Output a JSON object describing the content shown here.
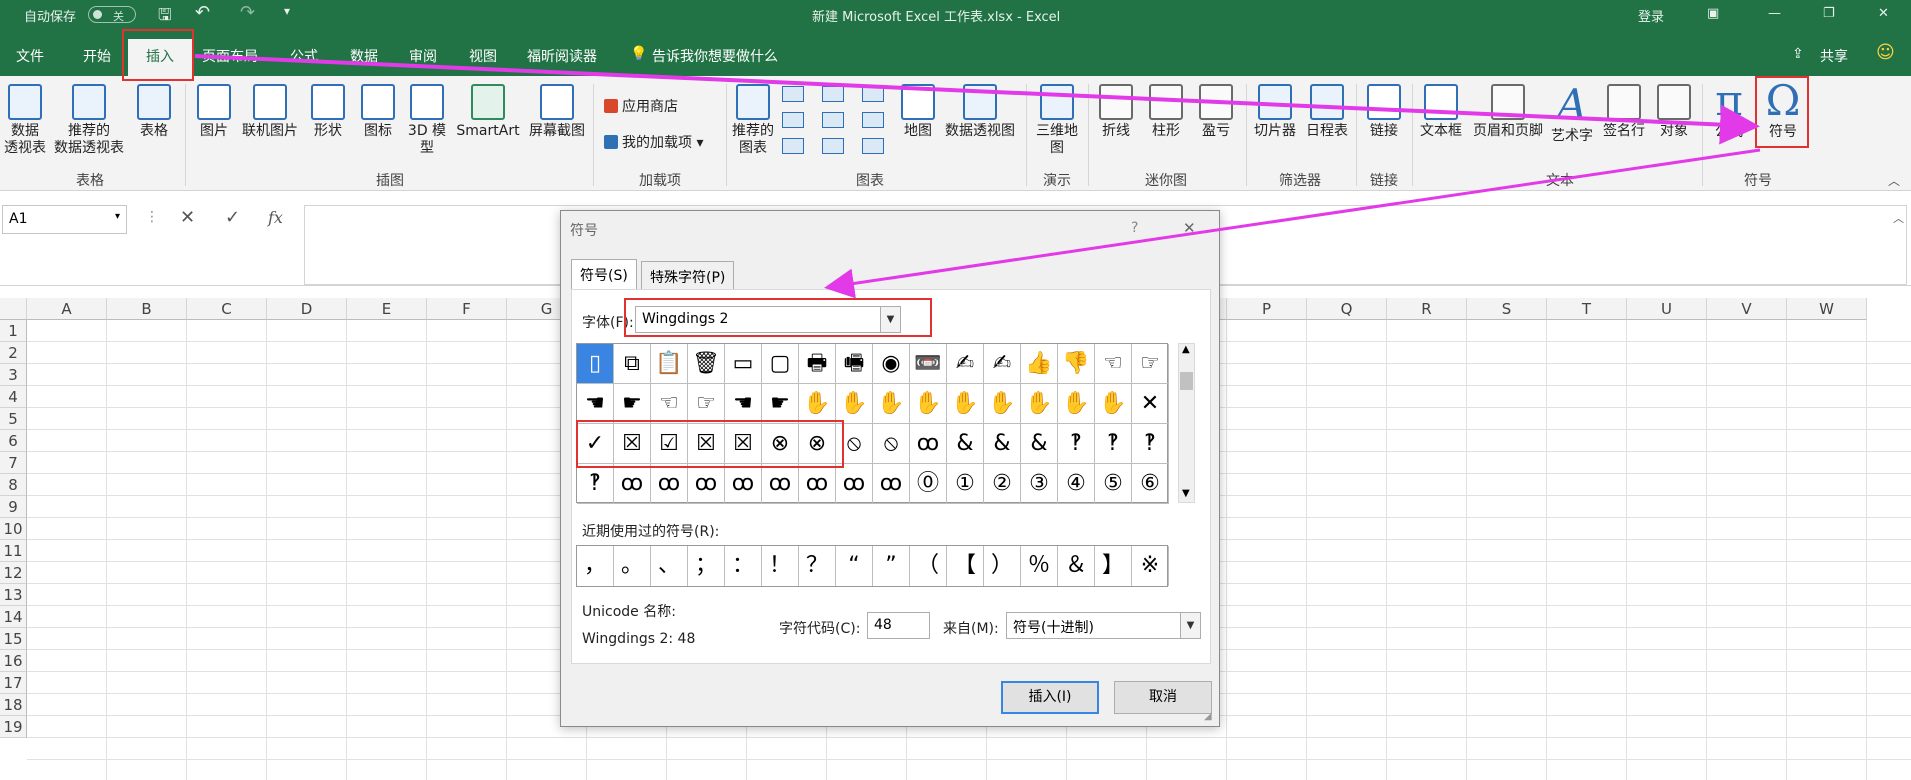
{
  "titlebar": {
    "autosave_label": "自动保存",
    "autosave_state": "关",
    "document_title": "新建 Microsoft Excel 工作表.xlsx  -  Excel",
    "login": "登录",
    "colors": {
      "excel_green": "#217346"
    }
  },
  "menu": {
    "tabs": [
      "文件",
      "开始",
      "插入",
      "页面布局",
      "公式",
      "数据",
      "审阅",
      "视图",
      "福昕阅读器"
    ],
    "active_tab": "插入",
    "tell_me": "告诉我你想要做什么",
    "share": "共享"
  },
  "ribbon": {
    "buttons": {
      "pivot": "数据\n透视表",
      "rec_pivot": "推荐的\n数据透视表",
      "table": "表格",
      "picture": "图片",
      "online_picture": "联机图片",
      "shapes": "形状",
      "icons": "图标",
      "models3d": "3D 模\n型",
      "smartart": "SmartArt",
      "screenshot": "屏幕截图",
      "store": "应用商店",
      "my_addins": "我的加载项",
      "rec_charts": "推荐的\n图表",
      "map": "地图",
      "pivot_chart": "数据透视图",
      "map3d": "三维地\n图",
      "line": "折线",
      "column": "柱形",
      "winloss": "盈亏",
      "slicer": "切片器",
      "timeline": "日程表",
      "link": "链接",
      "textbox": "文本框",
      "header_footer": "页眉和页脚",
      "wordart": "艺术字",
      "signature": "签名行",
      "object": "对象",
      "equation": "公式",
      "symbol": "符号"
    },
    "groups": {
      "tables": "表格",
      "illustrations": "插图",
      "addins": "加载项",
      "charts": "图表",
      "tours": "演示",
      "sparklines": "迷你图",
      "filters": "筛选器",
      "links": "链接",
      "text": "文本",
      "symbols": "符号"
    }
  },
  "formula_bar": {
    "name_box": "A1",
    "cancel": "✕",
    "enter": "✓",
    "fx": "fx"
  },
  "sheet": {
    "columns": [
      "A",
      "B",
      "C",
      "D",
      "E",
      "F",
      "G",
      "H",
      "I",
      "J",
      "K",
      "L",
      "M",
      "N",
      "O",
      "P",
      "Q",
      "R",
      "S",
      "T",
      "U",
      "V",
      "W"
    ],
    "rows": [
      "1",
      "2",
      "3",
      "4",
      "5",
      "6",
      "7",
      "8",
      "9",
      "10",
      "11",
      "12",
      "13",
      "14",
      "15",
      "16",
      "17",
      "18",
      "19"
    ]
  },
  "dialog": {
    "title": "符号",
    "help": "?",
    "close": "✕",
    "tab_symbols": "符号(S)",
    "tab_special": "特殊字符(P)",
    "font_label": "字体(F):",
    "font_value": "Wingdings 2",
    "symbol_rows": [
      [
        "▯",
        "⧉",
        "📋",
        "🗑",
        "▭",
        "▢",
        "🖶",
        "🖷",
        "◉",
        "📼",
        "✍",
        "✍",
        "👍",
        "👎",
        "☜",
        "☞"
      ],
      [
        "☚",
        "☛",
        "☜",
        "☞",
        "☚",
        "☛",
        "✋",
        "✋",
        "✋",
        "✋",
        "✋",
        "✋",
        "✋",
        "✋",
        "✋",
        "✕"
      ],
      [
        "✓",
        "☒",
        "☑",
        "☒",
        "☒",
        "⊗",
        "⊗",
        "⦸",
        "⦸",
        "ꝏ",
        "&",
        "&",
        "&",
        "‽",
        "‽",
        "‽"
      ],
      [
        "‽",
        "ꝏ",
        "ꝏ",
        "ꝏ",
        "ꝏ",
        "ꝏ",
        "ꝏ",
        "ꝏ",
        "ꝏ",
        "⓪",
        "①",
        "②",
        "③",
        "④",
        "⑤",
        "⑥"
      ]
    ],
    "recent_label": "近期使用过的符号(R):",
    "recent": [
      "，",
      "。",
      "、",
      "；",
      "：",
      "！",
      "？",
      "“",
      "”",
      "（",
      "【",
      "）",
      "％",
      "＆",
      "】",
      "※"
    ],
    "unicode_name_label": "Unicode 名称:",
    "unicode_name_value": "Wingdings 2: 48",
    "char_code_label": "字符代码(C):",
    "char_code_value": "48",
    "from_label": "来自(M):",
    "from_value": "符号(十进制)",
    "insert": "插入(I)",
    "cancel": "取消"
  },
  "annotations": {
    "highlight_color": "#e0322f",
    "arrow_color": "#e23ae8"
  }
}
